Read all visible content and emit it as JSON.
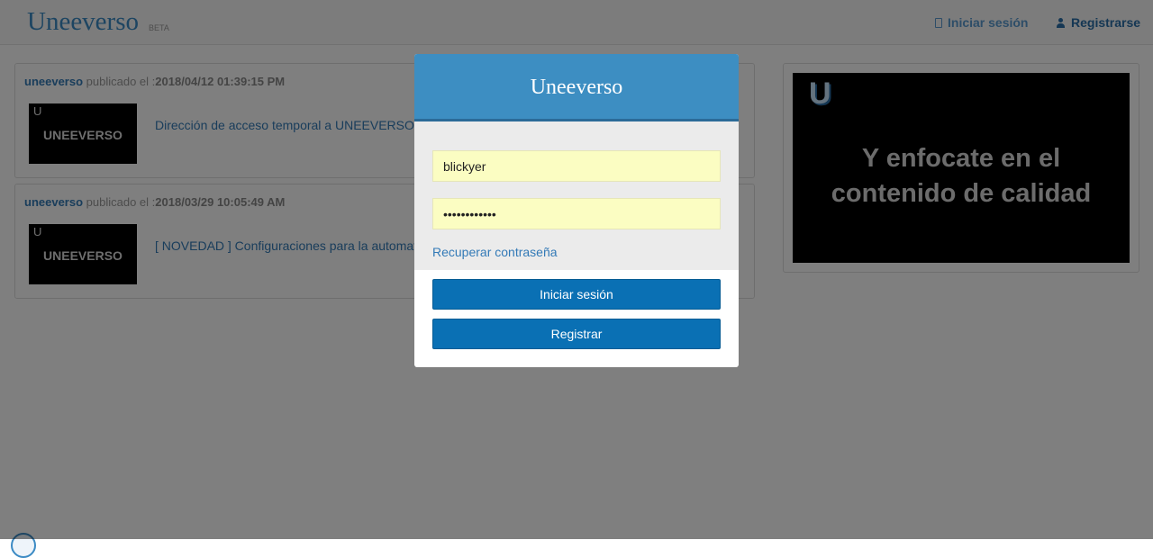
{
  "navbar": {
    "brand": "Uneeverso",
    "beta": "BETA",
    "login_label": "Iniciar sesión",
    "register_label": "Registrarse"
  },
  "posts": [
    {
      "author": "uneeverso",
      "published_text": " publicado el :",
      "date": "2018/04/12 01:39:15 PM",
      "thumb_letter": "U",
      "thumb_text": "UNEEVERSO",
      "title": "Dirección de acceso temporal a UNEEVERSO"
    },
    {
      "author": "uneeverso",
      "published_text": " publicado el :",
      "date": "2018/03/29 10:05:49 AM",
      "thumb_letter": "U",
      "thumb_text": "UNEEVERSO",
      "title": "[ NOVEDAD ] Configuraciones para la automat"
    }
  ],
  "side_panel": {
    "logo_letter": "U",
    "message_line1": "Y enfocate en el",
    "message_line2": "contenido de calidad"
  },
  "modal": {
    "title": "Uneeverso",
    "username_value": "blickyer",
    "password_value": "••••••••••••",
    "recover_label": "Recuperar contraseña",
    "login_button": "Iniciar sesión",
    "register_button": "Registrar"
  },
  "colors": {
    "accent": "#3d8ec2",
    "button": "#0a70b4",
    "input_bg": "#fbfdc2",
    "link": "#337ab7"
  }
}
